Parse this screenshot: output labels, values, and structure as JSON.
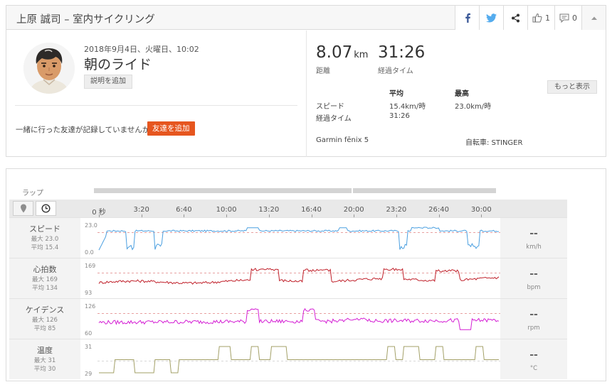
{
  "header": {
    "title": "上原 誠司 – 室内サイクリング",
    "kudos_count": "1",
    "comment_count": "0",
    "icons": [
      "facebook-icon",
      "twitter-icon",
      "share-icon",
      "thumbs-up-icon",
      "comment-icon",
      "collapse-icon"
    ],
    "colors": {
      "facebook": "#3b5998",
      "twitter": "#55acee"
    }
  },
  "activity": {
    "datetime": "2018年9月4日、火曜日、10:02",
    "name": "朝のライド",
    "add_description": "説明を追加",
    "friends_question": "一緒に行った友達が記録していませんか？",
    "add_friends": "友達を追加"
  },
  "stats": {
    "distance": "8.07",
    "distance_unit": "km",
    "distance_label": "距離",
    "elapsed": "31:26",
    "elapsed_label": "経過タイム",
    "more_button": "もっと表示",
    "col_avg": "平均",
    "col_max": "最高",
    "rows": [
      {
        "label": "スピード",
        "avg": "15.4km/時",
        "max": "23.0km/時"
      },
      {
        "label": "経過タイム",
        "avg": "31:26",
        "max": ""
      }
    ],
    "device": "Garmin fēnix 5",
    "bike": "自転車: STINGER"
  },
  "analysis": {
    "laps_label": "ラップ",
    "time_ticks": [
      "0 秒",
      "3:20",
      "6:40",
      "10:00",
      "13:20",
      "16:40",
      "20:00",
      "23:20",
      "26:40",
      "30:00"
    ],
    "streams": [
      {
        "name": "スピード",
        "max_label": "最大 23.0",
        "avg_label": "平均 15.4",
        "axis_top": "23.0",
        "axis_bottom": "0.0",
        "value": "--",
        "unit": "km/h",
        "color": "#4a9fe0"
      },
      {
        "name": "心拍数",
        "max_label": "最大 169",
        "avg_label": "平均 134",
        "axis_top": "169",
        "axis_bottom": "93",
        "value": "--",
        "unit": "bpm",
        "color": "#c0202a"
      },
      {
        "name": "ケイデンス",
        "max_label": "最大 126",
        "avg_label": "平均 85",
        "axis_top": "126",
        "axis_bottom": "60",
        "value": "--",
        "unit": "rpm",
        "color": "#d41ed4"
      },
      {
        "name": "温度",
        "max_label": "最大 31",
        "avg_label": "平均 30",
        "axis_top": "31",
        "axis_bottom": "29",
        "value": "--",
        "unit": "°C",
        "color": "#a3a067"
      }
    ]
  }
}
